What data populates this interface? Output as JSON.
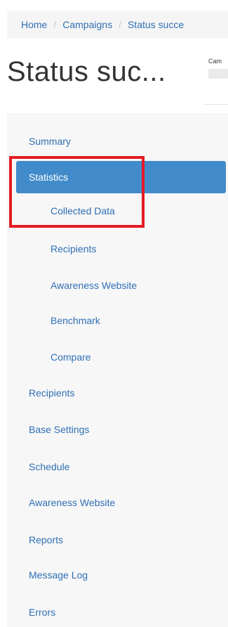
{
  "breadcrumb": {
    "items": [
      "Home",
      "Campaigns",
      "Status succe"
    ],
    "separator": "/"
  },
  "page": {
    "title": "Status suc...",
    "tab_label": "Cam"
  },
  "sidebar": {
    "items": [
      {
        "label": "Summary",
        "level": 0,
        "active": false
      },
      {
        "label": "Statistics",
        "level": 0,
        "active": true
      },
      {
        "label": "Collected Data",
        "level": 1,
        "active": false
      },
      {
        "label": "Recipients",
        "level": 1,
        "active": false
      },
      {
        "label": "Awareness Website",
        "level": 1,
        "active": false
      },
      {
        "label": "Benchmark",
        "level": 1,
        "active": false
      },
      {
        "label": "Compare",
        "level": 1,
        "active": false
      },
      {
        "label": "Recipients",
        "level": 0,
        "active": false
      },
      {
        "label": "Base Settings",
        "level": 0,
        "active": false
      },
      {
        "label": "Schedule",
        "level": 0,
        "active": false
      },
      {
        "label": "Awareness Website",
        "level": 0,
        "active": false
      },
      {
        "label": "Reports",
        "level": 0,
        "active": false
      },
      {
        "label": "Message Log",
        "level": 0,
        "active": false
      },
      {
        "label": "Errors",
        "level": 0,
        "active": false
      }
    ]
  },
  "colors": {
    "link": "#2f6fb5",
    "active_bg": "#428bca",
    "annotation": "#e31b23"
  }
}
